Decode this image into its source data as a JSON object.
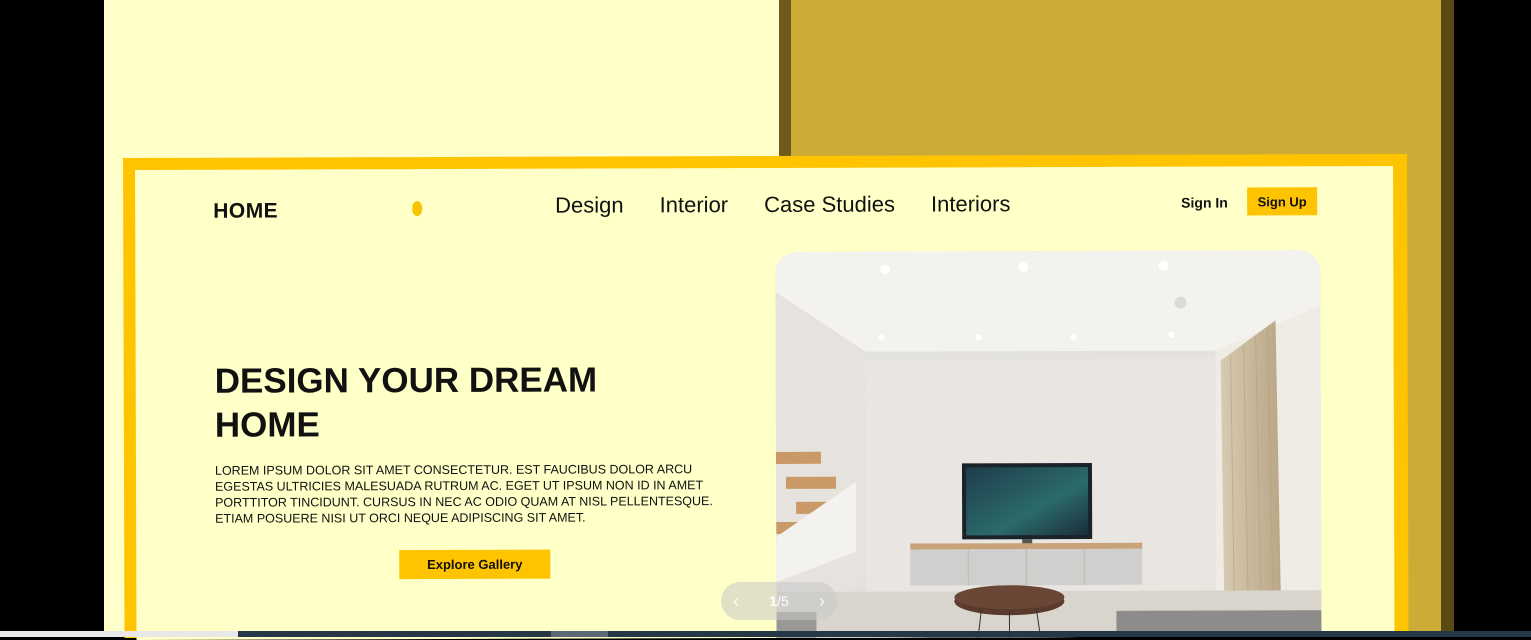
{
  "nav": {
    "logo": "HOME",
    "items": [
      "Design",
      "Interior",
      "Case Studies",
      "Interiors"
    ],
    "sign_in": "Sign In",
    "sign_up": "Sign Up"
  },
  "hero": {
    "headline": "DESIGN YOUR DREAM HOME",
    "description": "LOREM IPSUM DOLOR SIT AMET CONSECTETUR. EST FAUCIBUS DOLOR ARCU EGESTAS ULTRICIES MALESUADA RUTRUM AC. EGET UT IPSUM NON ID IN AMET PORTTITOR TINCIDUNT. CURSUS IN NEC AC ODIO QUAM AT NISL PELLENTESQUE. ETIAM POSUERE NISI UT ORCI NEQUE ADIPISCING SIT AMET.",
    "cta": "Explore Gallery"
  },
  "carousel": {
    "current": "1",
    "separator": "/",
    "total": "5",
    "prev_icon": "chevron-left-icon",
    "next_icon": "chevron-right-icon"
  },
  "colors": {
    "accent": "#ffc400",
    "page_bg": "#ffffc8",
    "right_panel": "#ccac36",
    "text": "#111111"
  }
}
